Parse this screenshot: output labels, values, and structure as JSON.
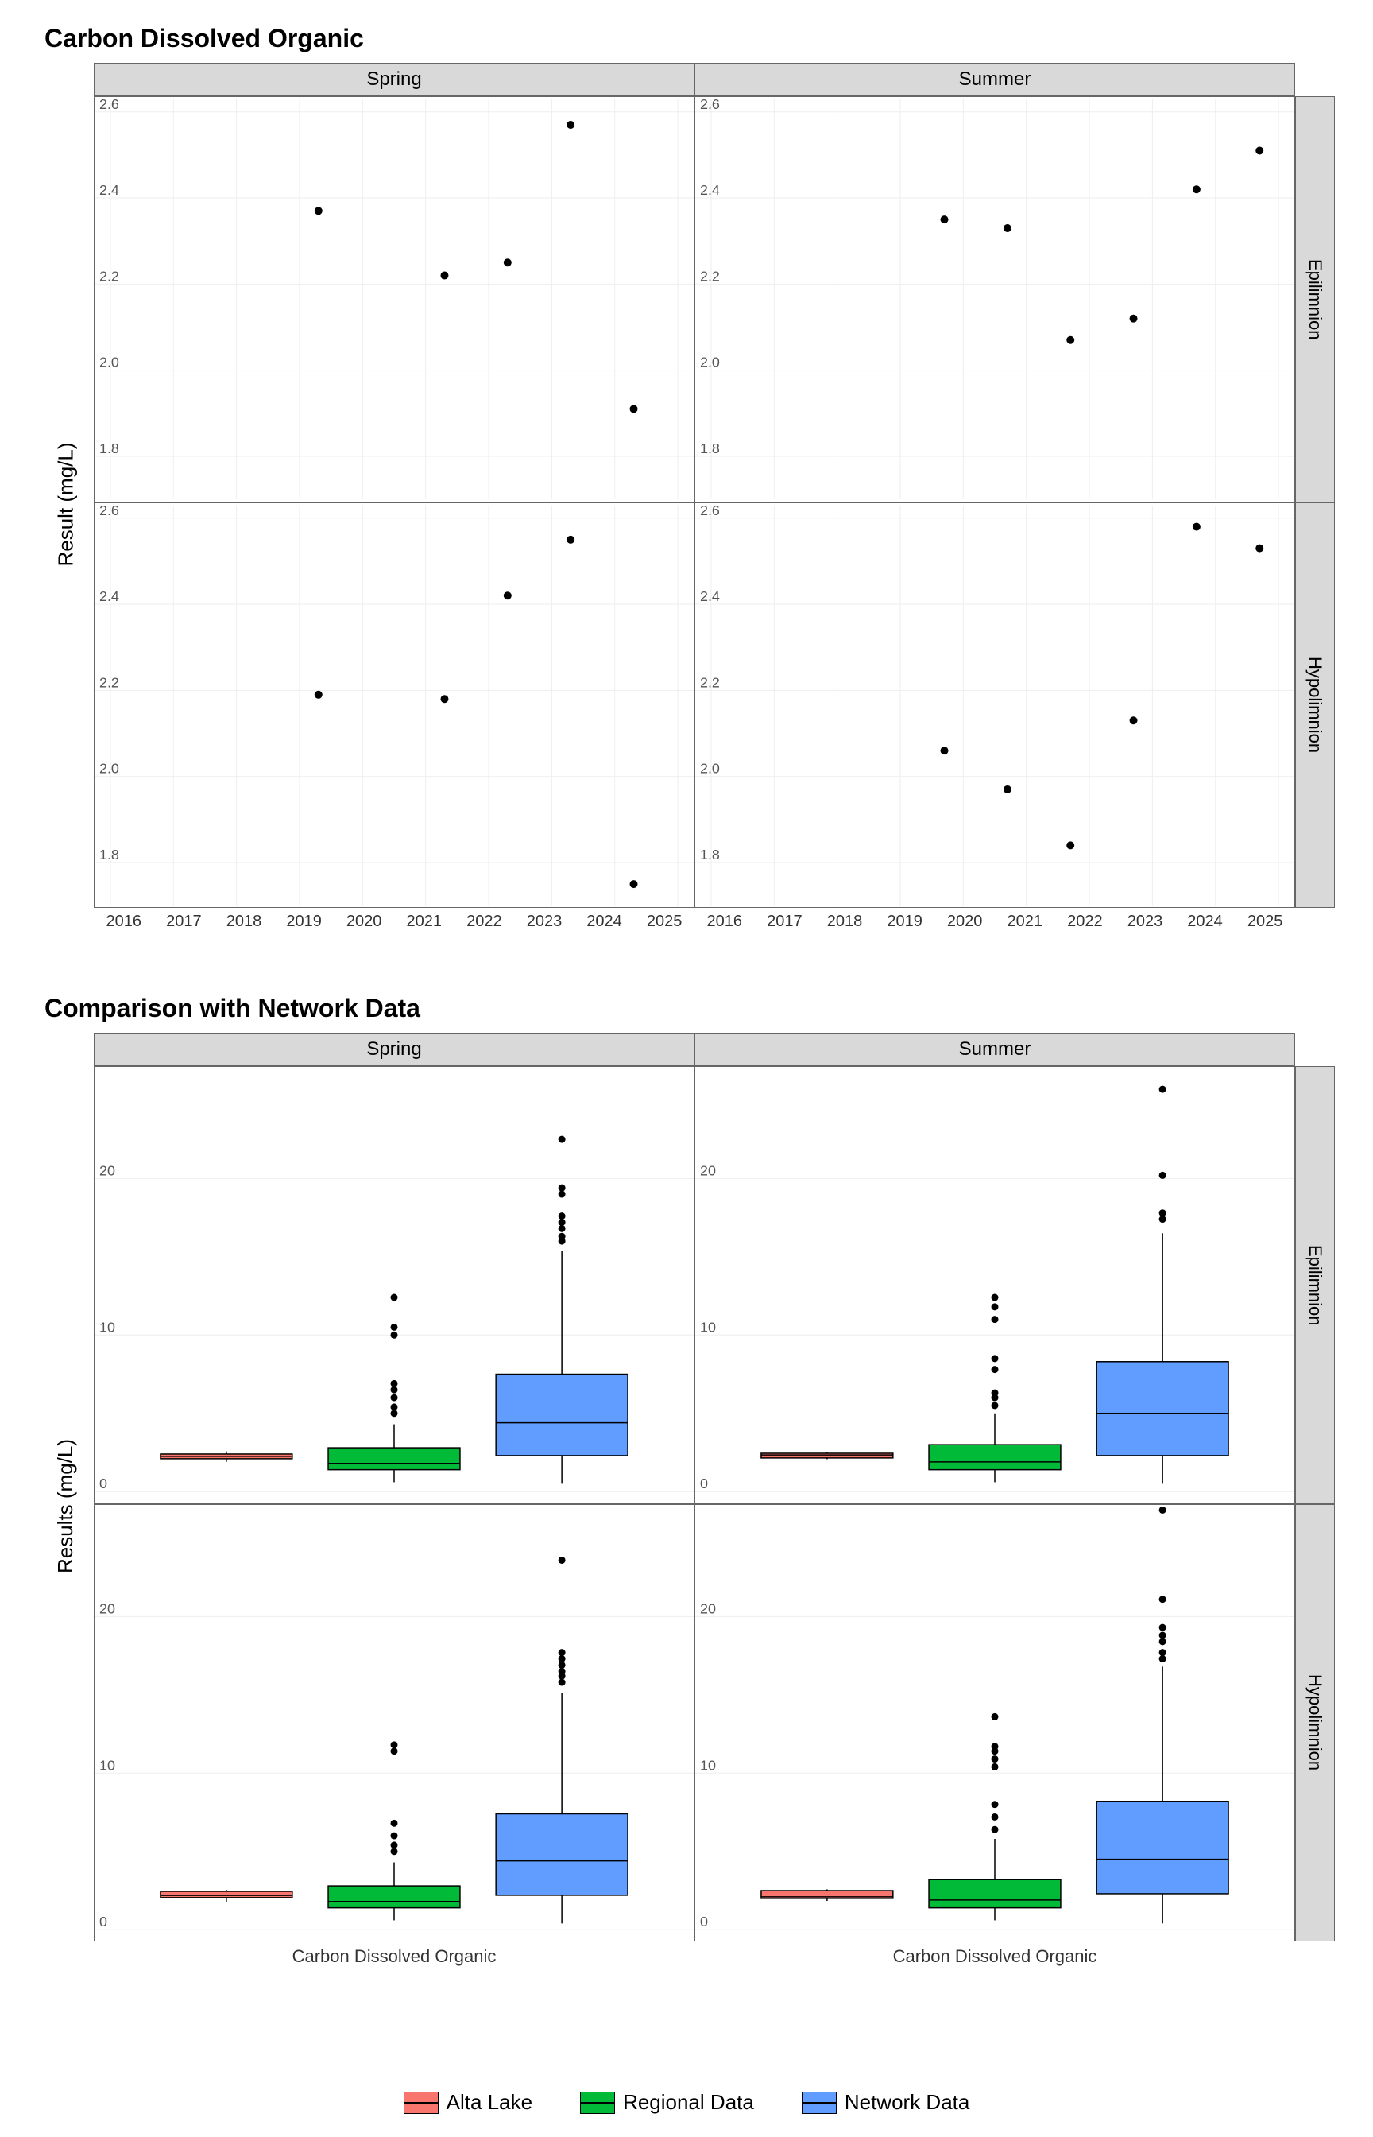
{
  "chart_data": [
    {
      "type": "scatter",
      "title": "Carbon Dissolved Organic",
      "ylabel": "Result (mg/L)",
      "ylim": [
        1.7,
        2.63
      ],
      "yticks": [
        1.8,
        2.0,
        2.2,
        2.4,
        2.6
      ],
      "x_years": [
        2016,
        2017,
        2018,
        2019,
        2020,
        2021,
        2022,
        2023,
        2024,
        2025
      ],
      "col_facets": [
        "Spring",
        "Summer"
      ],
      "row_facets": [
        "Epilimnion",
        "Hypolimnion"
      ],
      "panels": {
        "Spring_Epilimnion": [
          {
            "x": 2019.3,
            "y": 2.37
          },
          {
            "x": 2021.3,
            "y": 2.22
          },
          {
            "x": 2022.3,
            "y": 2.25
          },
          {
            "x": 2023.3,
            "y": 2.57
          },
          {
            "x": 2024.3,
            "y": 1.91
          }
        ],
        "Summer_Epilimnion": [
          {
            "x": 2019.7,
            "y": 2.35
          },
          {
            "x": 2020.7,
            "y": 2.33
          },
          {
            "x": 2021.7,
            "y": 2.07
          },
          {
            "x": 2022.7,
            "y": 2.12
          },
          {
            "x": 2023.7,
            "y": 2.42
          },
          {
            "x": 2024.7,
            "y": 2.51
          }
        ],
        "Spring_Hypolimnion": [
          {
            "x": 2019.3,
            "y": 2.19
          },
          {
            "x": 2021.3,
            "y": 2.18
          },
          {
            "x": 2022.3,
            "y": 2.42
          },
          {
            "x": 2023.3,
            "y": 2.55
          },
          {
            "x": 2024.3,
            "y": 1.75
          }
        ],
        "Summer_Hypolimnion": [
          {
            "x": 2019.7,
            "y": 2.06
          },
          {
            "x": 2020.7,
            "y": 1.97
          },
          {
            "x": 2021.7,
            "y": 1.84
          },
          {
            "x": 2022.7,
            "y": 2.13
          },
          {
            "x": 2023.7,
            "y": 2.58
          },
          {
            "x": 2024.7,
            "y": 2.53
          }
        ]
      }
    },
    {
      "type": "box",
      "title": "Comparison with Network Data",
      "ylabel": "Results (mg/L)",
      "xlabel": "Carbon Dissolved Organic",
      "ylim": [
        -0.6,
        27.0
      ],
      "yticks": [
        0,
        10,
        20
      ],
      "col_facets": [
        "Spring",
        "Summer"
      ],
      "row_facets": [
        "Epilimnion",
        "Hypolimnion"
      ],
      "legend": [
        {
          "name": "Alta Lake",
          "color": "#F8766D"
        },
        {
          "name": "Regional Data",
          "color": "#00BA38"
        },
        {
          "name": "Network Data",
          "color": "#619CFF"
        }
      ],
      "panels": {
        "Spring_Epilimnion": {
          "boxes": [
            {
              "g": "Alta Lake",
              "min": 1.9,
              "q1": 2.1,
              "med": 2.25,
              "q3": 2.4,
              "max": 2.57,
              "outliers": []
            },
            {
              "g": "Regional Data",
              "min": 0.6,
              "q1": 1.4,
              "med": 1.8,
              "q3": 2.8,
              "max": 4.3,
              "outliers": [
                5.0,
                5.4,
                6.0,
                6.5,
                6.9,
                10.0,
                10.5,
                12.4
              ]
            },
            {
              "g": "Network Data",
              "min": 0.5,
              "q1": 2.3,
              "med": 4.4,
              "q3": 7.5,
              "max": 15.4,
              "outliers": [
                16.0,
                16.3,
                16.8,
                17.2,
                17.6,
                19.0,
                19.4,
                22.5
              ]
            }
          ]
        },
        "Summer_Epilimnion": {
          "boxes": [
            {
              "g": "Alta Lake",
              "min": 2.07,
              "q1": 2.15,
              "med": 2.34,
              "q3": 2.45,
              "max": 2.51,
              "outliers": []
            },
            {
              "g": "Regional Data",
              "min": 0.6,
              "q1": 1.4,
              "med": 1.9,
              "q3": 3.0,
              "max": 5.0,
              "outliers": [
                5.5,
                6.0,
                6.3,
                7.8,
                8.5,
                11.0,
                11.8,
                12.4
              ]
            },
            {
              "g": "Network Data",
              "min": 0.5,
              "q1": 2.3,
              "med": 5.0,
              "q3": 8.3,
              "max": 16.5,
              "outliers": [
                17.4,
                17.8,
                20.2,
                25.7
              ]
            }
          ]
        },
        "Spring_Hypolimnion": {
          "boxes": [
            {
              "g": "Alta Lake",
              "min": 1.75,
              "q1": 2.05,
              "med": 2.19,
              "q3": 2.45,
              "max": 2.55,
              "outliers": []
            },
            {
              "g": "Regional Data",
              "min": 0.6,
              "q1": 1.4,
              "med": 1.8,
              "q3": 2.8,
              "max": 4.3,
              "outliers": [
                5.0,
                5.4,
                6.0,
                6.8,
                11.4,
                11.8
              ]
            },
            {
              "g": "Network Data",
              "min": 0.4,
              "q1": 2.2,
              "med": 4.4,
              "q3": 7.4,
              "max": 15.1,
              "outliers": [
                15.8,
                16.2,
                16.5,
                16.9,
                17.3,
                17.7,
                23.6
              ]
            }
          ]
        },
        "Summer_Hypolimnion": {
          "boxes": [
            {
              "g": "Alta Lake",
              "min": 1.84,
              "q1": 2.0,
              "med": 2.1,
              "q3": 2.5,
              "max": 2.58,
              "outliers": []
            },
            {
              "g": "Regional Data",
              "min": 0.6,
              "q1": 1.4,
              "med": 1.9,
              "q3": 3.2,
              "max": 5.8,
              "outliers": [
                6.4,
                7.2,
                8.0,
                10.4,
                10.9,
                11.4,
                11.7,
                13.6
              ]
            },
            {
              "g": "Network Data",
              "min": 0.4,
              "q1": 2.3,
              "med": 4.5,
              "q3": 8.2,
              "max": 16.8,
              "outliers": [
                17.3,
                17.7,
                18.4,
                18.8,
                19.3,
                21.1,
                26.8
              ]
            }
          ]
        }
      }
    }
  ]
}
